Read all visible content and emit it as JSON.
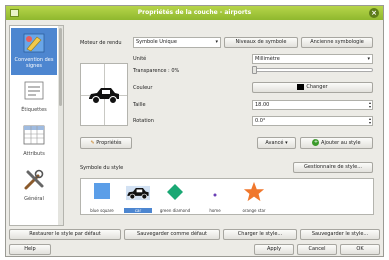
{
  "window": {
    "title": "Propriétés de la couche - airports"
  },
  "sidebar": {
    "items": [
      {
        "label": "Convention des signes",
        "icon": "style-brush-icon",
        "active": true
      },
      {
        "label": "Étiquettes",
        "icon": "labels-icon",
        "active": false
      },
      {
        "label": "Attributs",
        "icon": "attribute-table-icon",
        "active": false
      },
      {
        "label": "Général",
        "icon": "tools-icon",
        "active": false
      }
    ]
  },
  "renderer": {
    "label": "Moteur de rendu",
    "selected": "Symbole Unique",
    "symbol_levels_button": "Niveaux de symbole",
    "old_symbology_button": "Ancienne symbologie"
  },
  "symbol_props": {
    "unit_label": "Unité",
    "unit_value": "Millimètre",
    "transparency_label": "Transparence : 0%",
    "transparency_percent": 0,
    "color_label": "Couleur",
    "color_button": "Changer",
    "color_value": "#000000",
    "size_label": "Taille",
    "size_value": "18.00",
    "rotation_label": "Rotation",
    "rotation_value": "0.0°"
  },
  "actions": {
    "properties_button": "Propriétés",
    "advanced_button": "Avancé",
    "add_to_style_button": "Ajouter au style"
  },
  "style_section": {
    "label": "Symbole du style",
    "manager_button": "Gestionnaire de style...",
    "symbols": [
      {
        "name": "blue square",
        "icon": "blue-square-icon",
        "selected": false
      },
      {
        "name": "car",
        "icon": "car-icon",
        "selected": true
      },
      {
        "name": "green diamond",
        "icon": "green-diamond-icon",
        "selected": false
      },
      {
        "name": "home",
        "icon": "home-icon",
        "selected": false
      },
      {
        "name": "orange star",
        "icon": "orange-star-icon",
        "selected": false
      }
    ]
  },
  "bottom_row": {
    "restore_default": "Restaurer le style par défaut",
    "save_as_default": "Sauvegarder comme défaut",
    "load_style": "Charger le style...",
    "save_style": "Sauvegarder le style..."
  },
  "dialog_buttons": {
    "help": "Help",
    "apply": "Apply",
    "cancel": "Cancel",
    "ok": "OK"
  },
  "colors": {
    "titlebar": "#9cc23a",
    "selection": "#4d86d0",
    "square": "#5b9ee8",
    "diamond": "#1aa874",
    "star": "#f0772c"
  }
}
